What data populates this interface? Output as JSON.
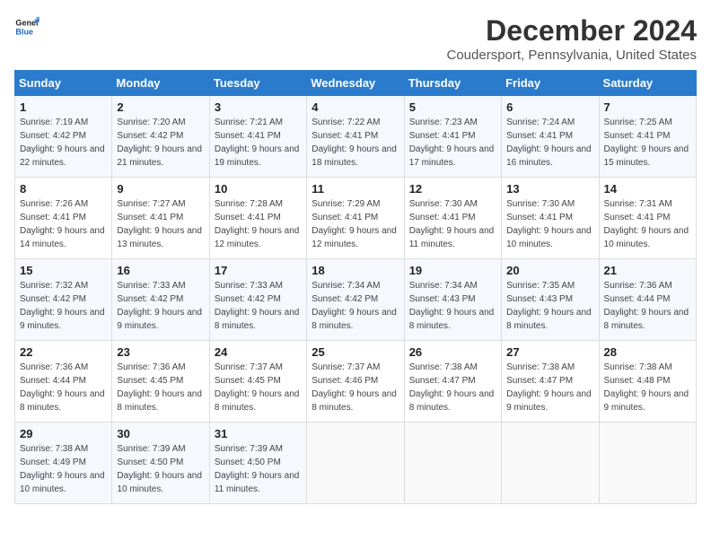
{
  "logo": {
    "line1": "General",
    "line2": "Blue"
  },
  "title": "December 2024",
  "subtitle": "Coudersport, Pennsylvania, United States",
  "days_of_week": [
    "Sunday",
    "Monday",
    "Tuesday",
    "Wednesday",
    "Thursday",
    "Friday",
    "Saturday"
  ],
  "weeks": [
    [
      {
        "day": "1",
        "sunrise": "7:19 AM",
        "sunset": "4:42 PM",
        "daylight": "9 hours and 22 minutes."
      },
      {
        "day": "2",
        "sunrise": "7:20 AM",
        "sunset": "4:42 PM",
        "daylight": "9 hours and 21 minutes."
      },
      {
        "day": "3",
        "sunrise": "7:21 AM",
        "sunset": "4:41 PM",
        "daylight": "9 hours and 19 minutes."
      },
      {
        "day": "4",
        "sunrise": "7:22 AM",
        "sunset": "4:41 PM",
        "daylight": "9 hours and 18 minutes."
      },
      {
        "day": "5",
        "sunrise": "7:23 AM",
        "sunset": "4:41 PM",
        "daylight": "9 hours and 17 minutes."
      },
      {
        "day": "6",
        "sunrise": "7:24 AM",
        "sunset": "4:41 PM",
        "daylight": "9 hours and 16 minutes."
      },
      {
        "day": "7",
        "sunrise": "7:25 AM",
        "sunset": "4:41 PM",
        "daylight": "9 hours and 15 minutes."
      }
    ],
    [
      {
        "day": "8",
        "sunrise": "7:26 AM",
        "sunset": "4:41 PM",
        "daylight": "9 hours and 14 minutes."
      },
      {
        "day": "9",
        "sunrise": "7:27 AM",
        "sunset": "4:41 PM",
        "daylight": "9 hours and 13 minutes."
      },
      {
        "day": "10",
        "sunrise": "7:28 AM",
        "sunset": "4:41 PM",
        "daylight": "9 hours and 12 minutes."
      },
      {
        "day": "11",
        "sunrise": "7:29 AM",
        "sunset": "4:41 PM",
        "daylight": "9 hours and 12 minutes."
      },
      {
        "day": "12",
        "sunrise": "7:30 AM",
        "sunset": "4:41 PM",
        "daylight": "9 hours and 11 minutes."
      },
      {
        "day": "13",
        "sunrise": "7:30 AM",
        "sunset": "4:41 PM",
        "daylight": "9 hours and 10 minutes."
      },
      {
        "day": "14",
        "sunrise": "7:31 AM",
        "sunset": "4:41 PM",
        "daylight": "9 hours and 10 minutes."
      }
    ],
    [
      {
        "day": "15",
        "sunrise": "7:32 AM",
        "sunset": "4:42 PM",
        "daylight": "9 hours and 9 minutes."
      },
      {
        "day": "16",
        "sunrise": "7:33 AM",
        "sunset": "4:42 PM",
        "daylight": "9 hours and 9 minutes."
      },
      {
        "day": "17",
        "sunrise": "7:33 AM",
        "sunset": "4:42 PM",
        "daylight": "9 hours and 8 minutes."
      },
      {
        "day": "18",
        "sunrise": "7:34 AM",
        "sunset": "4:42 PM",
        "daylight": "9 hours and 8 minutes."
      },
      {
        "day": "19",
        "sunrise": "7:34 AM",
        "sunset": "4:43 PM",
        "daylight": "9 hours and 8 minutes."
      },
      {
        "day": "20",
        "sunrise": "7:35 AM",
        "sunset": "4:43 PM",
        "daylight": "9 hours and 8 minutes."
      },
      {
        "day": "21",
        "sunrise": "7:36 AM",
        "sunset": "4:44 PM",
        "daylight": "9 hours and 8 minutes."
      }
    ],
    [
      {
        "day": "22",
        "sunrise": "7:36 AM",
        "sunset": "4:44 PM",
        "daylight": "9 hours and 8 minutes."
      },
      {
        "day": "23",
        "sunrise": "7:36 AM",
        "sunset": "4:45 PM",
        "daylight": "9 hours and 8 minutes."
      },
      {
        "day": "24",
        "sunrise": "7:37 AM",
        "sunset": "4:45 PM",
        "daylight": "9 hours and 8 minutes."
      },
      {
        "day": "25",
        "sunrise": "7:37 AM",
        "sunset": "4:46 PM",
        "daylight": "9 hours and 8 minutes."
      },
      {
        "day": "26",
        "sunrise": "7:38 AM",
        "sunset": "4:47 PM",
        "daylight": "9 hours and 8 minutes."
      },
      {
        "day": "27",
        "sunrise": "7:38 AM",
        "sunset": "4:47 PM",
        "daylight": "9 hours and 9 minutes."
      },
      {
        "day": "28",
        "sunrise": "7:38 AM",
        "sunset": "4:48 PM",
        "daylight": "9 hours and 9 minutes."
      }
    ],
    [
      {
        "day": "29",
        "sunrise": "7:38 AM",
        "sunset": "4:49 PM",
        "daylight": "9 hours and 10 minutes."
      },
      {
        "day": "30",
        "sunrise": "7:39 AM",
        "sunset": "4:50 PM",
        "daylight": "9 hours and 10 minutes."
      },
      {
        "day": "31",
        "sunrise": "7:39 AM",
        "sunset": "4:50 PM",
        "daylight": "9 hours and 11 minutes."
      },
      null,
      null,
      null,
      null
    ]
  ]
}
